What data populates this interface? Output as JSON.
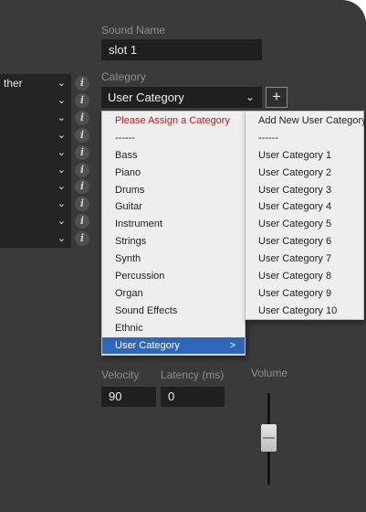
{
  "sound_name": {
    "label": "Sound Name",
    "value": "slot 1"
  },
  "category": {
    "label": "Category",
    "value": "User Category",
    "add_label": "+"
  },
  "left_column": {
    "rows": [
      {
        "text": "ther"
      },
      {
        "text": ""
      },
      {
        "text": ""
      },
      {
        "text": ""
      },
      {
        "text": ""
      },
      {
        "text": ""
      },
      {
        "text": ""
      },
      {
        "text": ""
      },
      {
        "text": ""
      },
      {
        "text": ""
      }
    ],
    "info_glyph": "i",
    "chevron_glyph": "⌄"
  },
  "dropdown": {
    "items": [
      {
        "label": "Please Assign a Category",
        "style": "warn"
      },
      {
        "label": "------",
        "style": ""
      },
      {
        "label": "Bass",
        "style": ""
      },
      {
        "label": "Piano",
        "style": ""
      },
      {
        "label": "Drums",
        "style": ""
      },
      {
        "label": "Guitar",
        "style": ""
      },
      {
        "label": "Instrument",
        "style": ""
      },
      {
        "label": "Strings",
        "style": ""
      },
      {
        "label": "Synth",
        "style": ""
      },
      {
        "label": "Percussion",
        "style": ""
      },
      {
        "label": "Organ",
        "style": ""
      },
      {
        "label": "Sound Effects",
        "style": ""
      },
      {
        "label": "Ethnic",
        "style": ""
      },
      {
        "label": "User Category",
        "style": "sel",
        "submenu": true
      }
    ],
    "submenu_arrow": ">"
  },
  "submenu": {
    "items": [
      "Add New User Category",
      "------",
      "User Category 1",
      "User Category 2",
      "User Category 3",
      "User Category 4",
      "User Category 5",
      "User Category 6",
      "User Category 7",
      "User Category 8",
      "User Category 9",
      "User Category 10"
    ]
  },
  "velocity": {
    "label": "Velocity",
    "value": "90"
  },
  "latency": {
    "label": "Latency (ms)",
    "value": "0"
  },
  "volume": {
    "label": "Volume"
  },
  "colors": {
    "panel": "#3a3a3a",
    "field": "#1f1f1f",
    "selected": "#2f66b8",
    "warning": "#b31d1d"
  }
}
